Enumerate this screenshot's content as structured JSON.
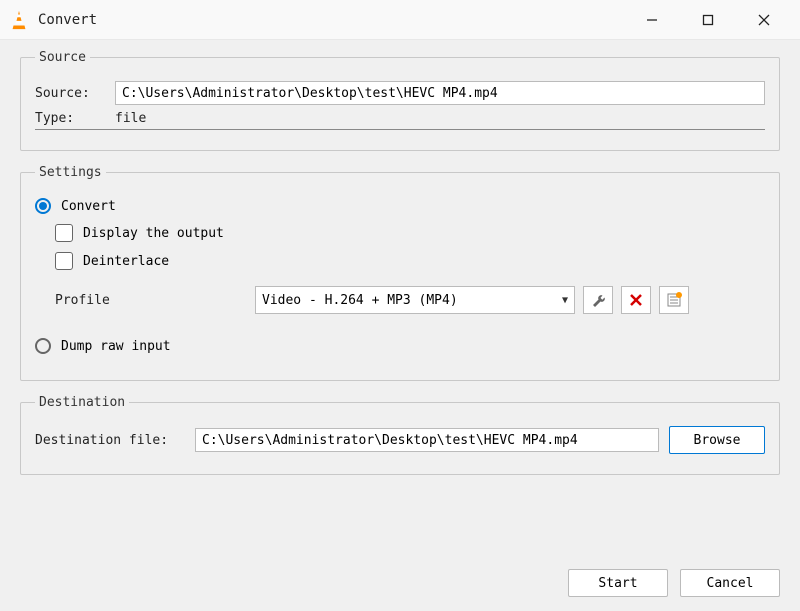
{
  "window": {
    "title": "Convert"
  },
  "source": {
    "legend": "Source",
    "source_label": "Source:",
    "source_value": "C:\\Users\\Administrator\\Desktop\\test\\HEVC MP4.mp4",
    "type_label": "Type:",
    "type_value": "file"
  },
  "settings": {
    "legend": "Settings",
    "convert_label": "Convert",
    "display_output_label": "Display the output",
    "deinterlace_label": "Deinterlace",
    "profile_label": "Profile",
    "profile_value": "Video - H.264 + MP3 (MP4)",
    "dump_raw_label": "Dump raw input"
  },
  "destination": {
    "legend": "Destination",
    "dest_file_label": "Destination file:",
    "dest_file_value": "C:\\Users\\Administrator\\Desktop\\test\\HEVC MP4.mp4",
    "browse_label": "Browse"
  },
  "buttons": {
    "start": "Start",
    "cancel": "Cancel"
  }
}
